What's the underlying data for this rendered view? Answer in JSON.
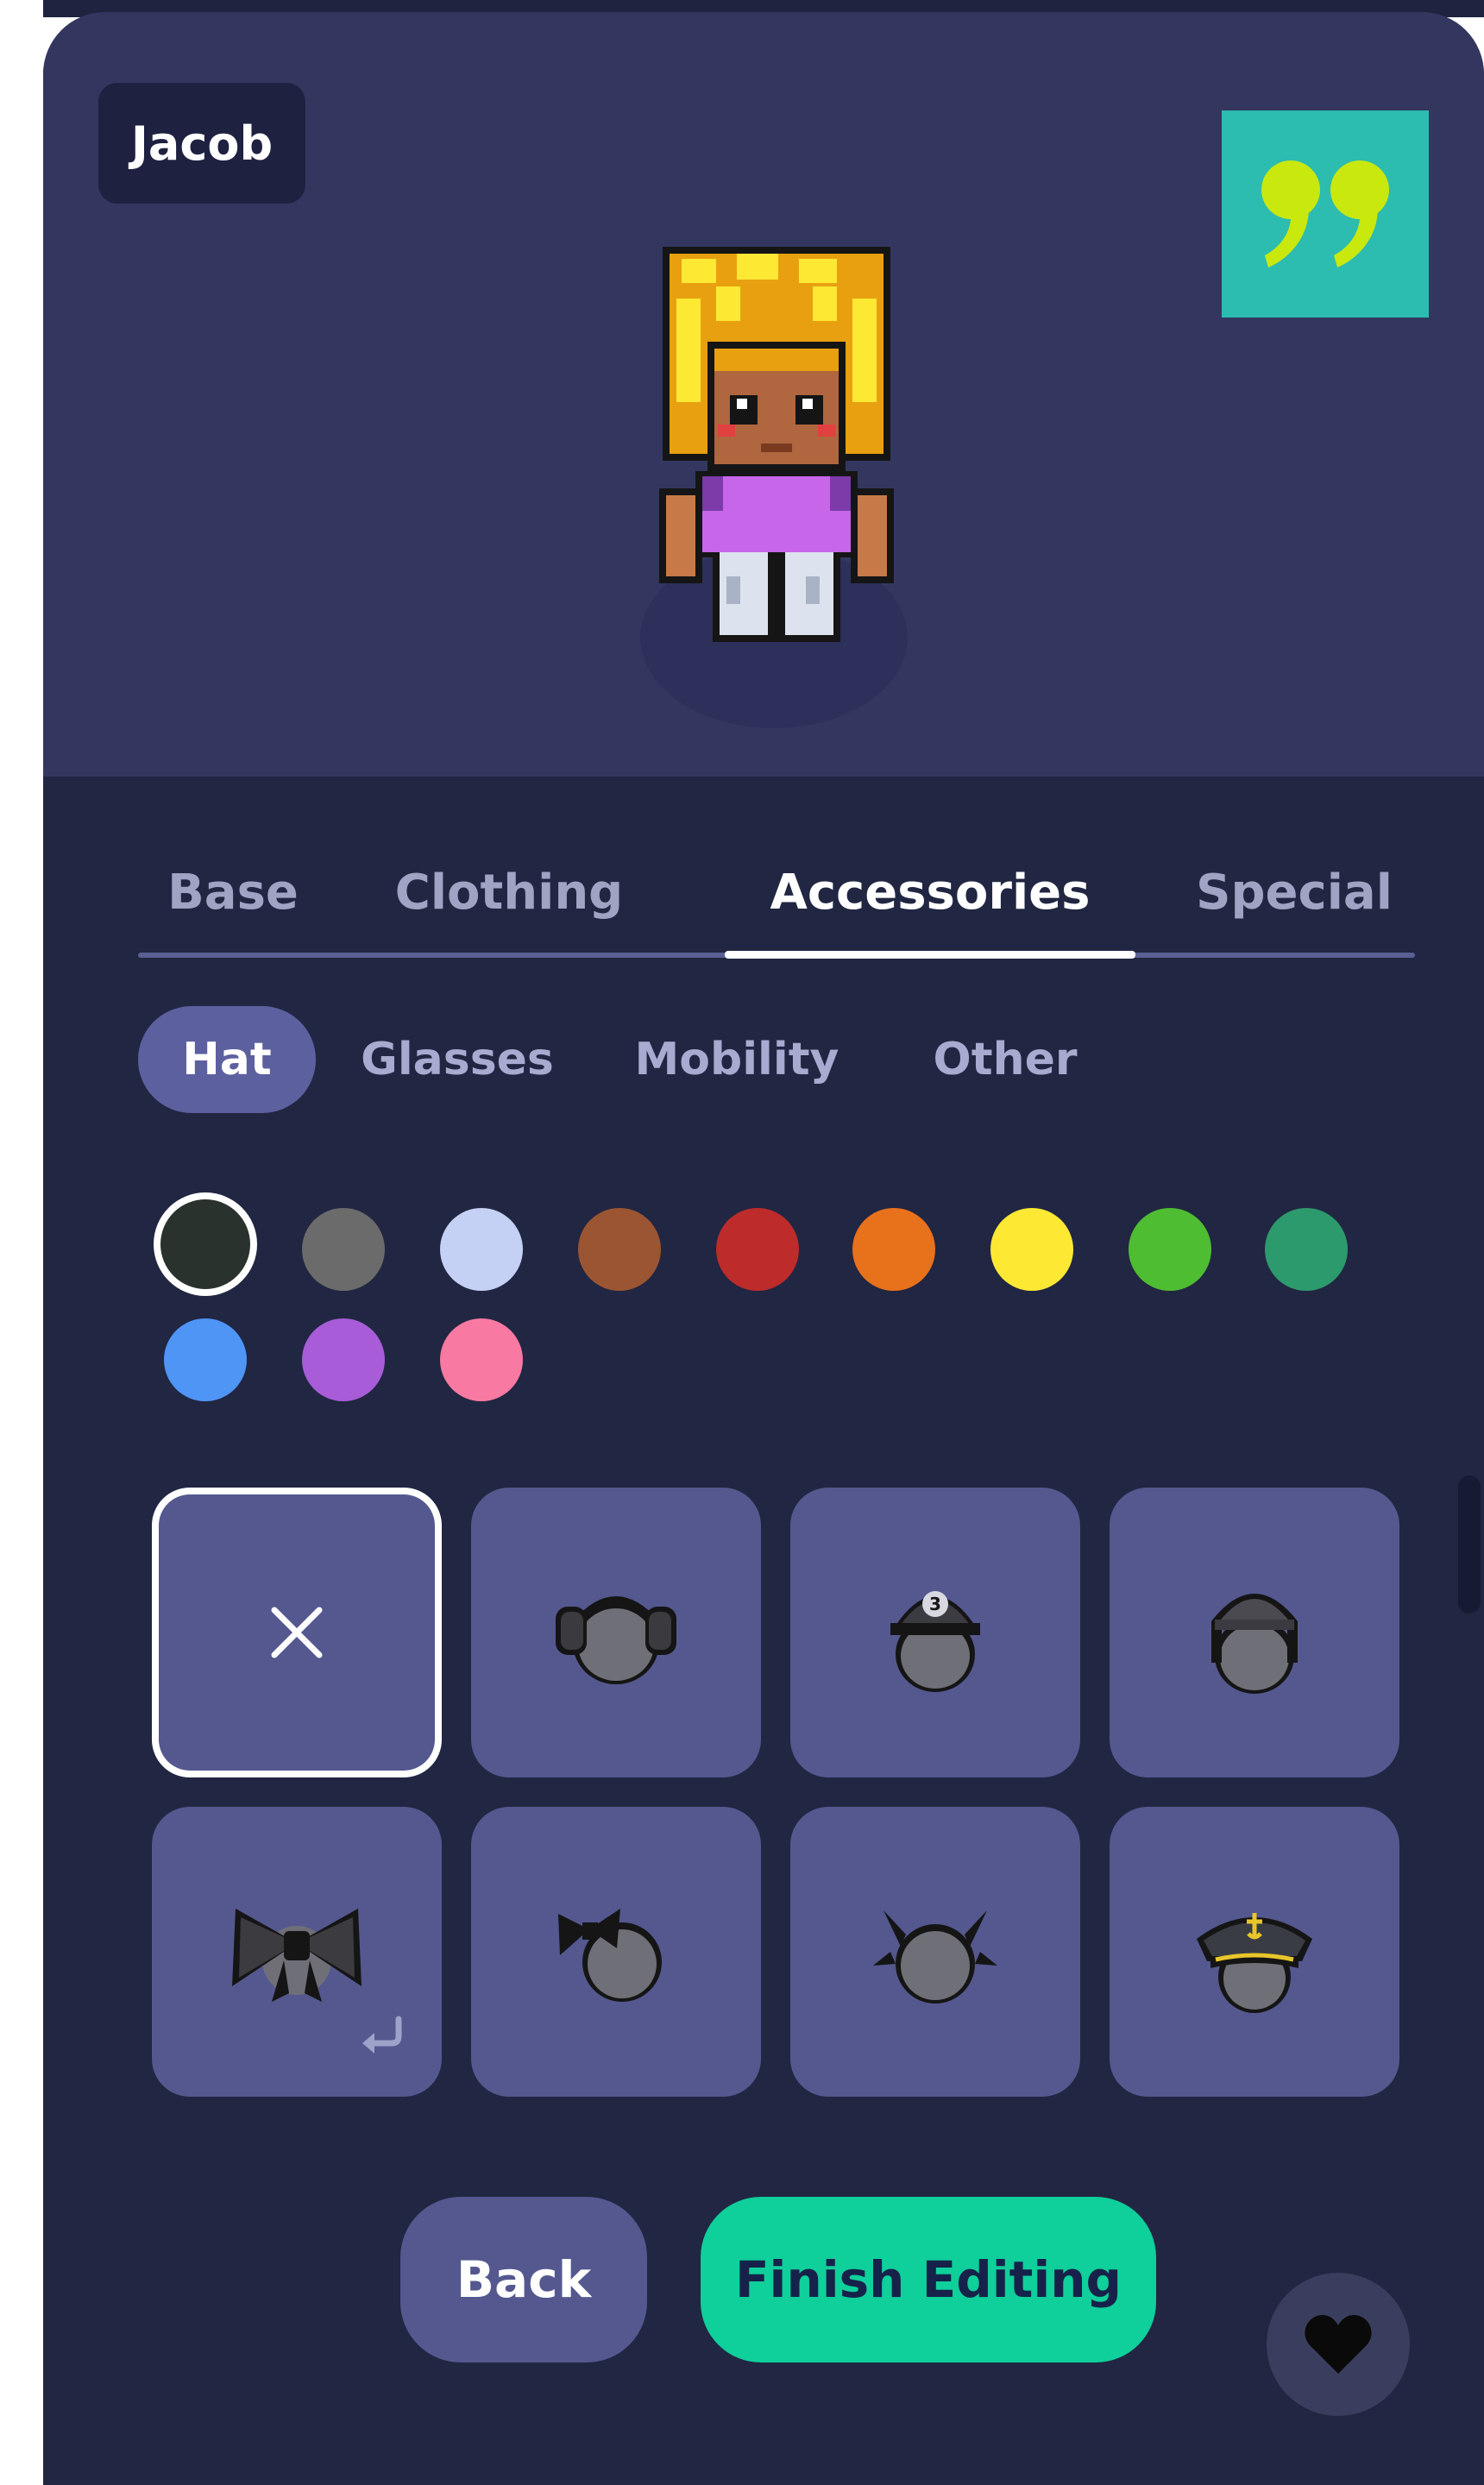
{
  "profile": {
    "name": "Jacob"
  },
  "quote_button": {
    "icon": "quote-icon",
    "bg_color": "#2cbcb0",
    "glyph_color": "#c9e80d"
  },
  "tabs": [
    {
      "label": "Base",
      "active": false
    },
    {
      "label": "Clothing",
      "active": false
    },
    {
      "label": "Accessories",
      "active": true
    },
    {
      "label": "Special",
      "active": false
    }
  ],
  "subtabs": [
    {
      "label": "Hat",
      "active": true
    },
    {
      "label": "Glasses",
      "active": false
    },
    {
      "label": "Mobility",
      "active": false
    },
    {
      "label": "Other",
      "active": false
    }
  ],
  "colors": [
    {
      "name": "black",
      "hex": "#2a322e",
      "selected": true
    },
    {
      "name": "gray",
      "hex": "#6b6b6b",
      "selected": false
    },
    {
      "name": "light-blue",
      "hex": "#c4d0f4",
      "selected": false
    },
    {
      "name": "brown",
      "hex": "#9b5533",
      "selected": false
    },
    {
      "name": "red",
      "hex": "#bd2b2b",
      "selected": false
    },
    {
      "name": "orange",
      "hex": "#e8711c",
      "selected": false
    },
    {
      "name": "yellow",
      "hex": "#fde934",
      "selected": false
    },
    {
      "name": "green",
      "hex": "#4fbd32",
      "selected": false
    },
    {
      "name": "teal",
      "hex": "#2c9a6d",
      "selected": false
    },
    {
      "name": "blue",
      "hex": "#4e95f5",
      "selected": false
    },
    {
      "name": "purple",
      "hex": "#a85cd8",
      "selected": false
    },
    {
      "name": "pink",
      "hex": "#f87aa2",
      "selected": false
    }
  ],
  "hats": [
    {
      "name": "none",
      "icon": "close-icon",
      "selected": true
    },
    {
      "name": "earmuffs",
      "icon": "earmuffs-icon",
      "selected": false
    },
    {
      "name": "cap",
      "icon": "cap-icon",
      "selected": false
    },
    {
      "name": "beanie",
      "icon": "beanie-icon",
      "selected": false
    },
    {
      "name": "big-bow",
      "icon": "bow-icon",
      "selected": false,
      "badge": "return-arrow-icon"
    },
    {
      "name": "side-bow",
      "icon": "side-bow-icon",
      "selected": false
    },
    {
      "name": "horns",
      "icon": "horns-icon",
      "selected": false
    },
    {
      "name": "captain-hat",
      "icon": "captain-hat-icon",
      "selected": false
    }
  ],
  "actions": {
    "back_label": "Back",
    "finish_label": "Finish Editing",
    "favorite_icon": "heart-icon"
  },
  "theme": {
    "finish_color": "#0fcf9a",
    "tile_color": "#54588f"
  }
}
